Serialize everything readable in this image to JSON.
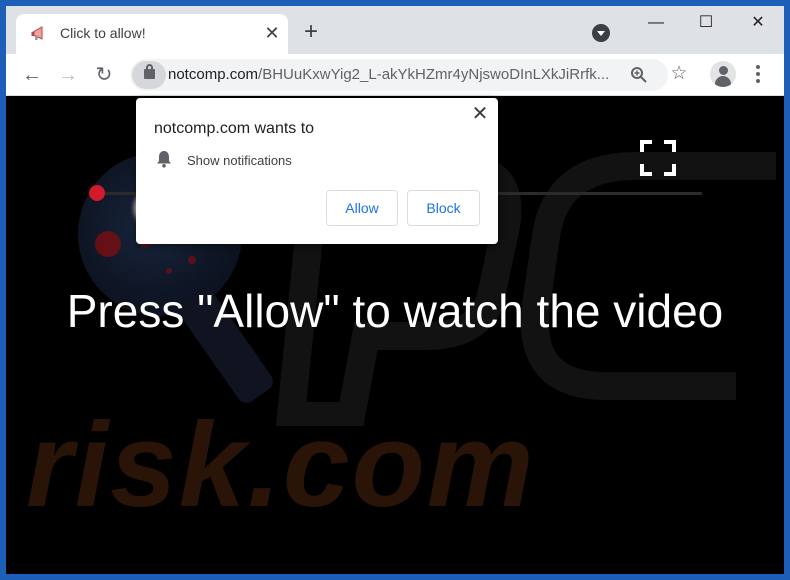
{
  "tab": {
    "title": "Click to allow!",
    "favicon": "megaphone-favicon",
    "close_glyph": "✕"
  },
  "new_tab_glyph": "+",
  "window_controls": {
    "minimize": "—",
    "maximize": "☐",
    "close": "✕"
  },
  "toolbar": {
    "back_glyph": "←",
    "forward_glyph": "→",
    "reload_glyph": "↻",
    "url_host": "notcomp.com",
    "url_path": "/BHUuKxwYig2_L-akYkHZmr4yNjswoDInLXkJiRrfk...",
    "star_glyph": "☆"
  },
  "popup": {
    "title": "notcomp.com wants to",
    "permission": "Show notifications",
    "allow_label": "Allow",
    "block_label": "Block",
    "close_glyph": "✕"
  },
  "content": {
    "headline": "Press \"Allow\" to watch the video",
    "watermark_text": "risk.com"
  },
  "colors": {
    "frame": "#1d5fb8",
    "tabstrip": "#dee1e6",
    "accent_blue": "#1a73e8",
    "progress_red": "#d11a2a",
    "watermark_orange": "#2a1408"
  }
}
